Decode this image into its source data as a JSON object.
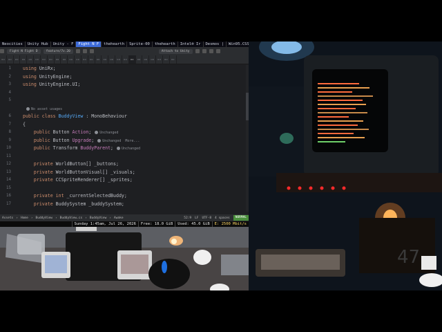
{
  "window_bar": {
    "tabs": [
      {
        "label": "Neocities",
        "active": false
      },
      {
        "label": "Unity Hub",
        "active": false
      },
      {
        "label": "Unity - F",
        "active": false
      },
      {
        "label": "Fight N F",
        "active": true
      },
      {
        "label": "thehearth",
        "active": false
      },
      {
        "label": "Sprite-00",
        "active": false
      },
      {
        "label": "thehearth",
        "active": false
      },
      {
        "label": "Intel® Ir",
        "active": false
      },
      {
        "label": "Desmos |",
        "active": false
      },
      {
        "label": "Win95.CSS",
        "active": false
      }
    ]
  },
  "ide": {
    "project_label": "Fight N Fight D",
    "branch_label": "feature/7v.20",
    "attach_label": "Attach to Unity",
    "code_lines": [
      {
        "n": "1",
        "parts": [
          {
            "t": "using",
            "c": "kw"
          },
          {
            "t": " UniRx;",
            "c": "ident"
          }
        ]
      },
      {
        "n": "2",
        "parts": [
          {
            "t": "using",
            "c": "kw"
          },
          {
            "t": " UnityEngine;",
            "c": "ident"
          }
        ]
      },
      {
        "n": "3",
        "parts": [
          {
            "t": "using",
            "c": "kw"
          },
          {
            "t": " UnityEngine.UI;",
            "c": "ident"
          }
        ]
      },
      {
        "n": "4",
        "parts": []
      },
      {
        "n": "5",
        "parts": []
      },
      {
        "n": "",
        "hint": "No asset usages"
      },
      {
        "n": "6",
        "parts": [
          {
            "t": "public class ",
            "c": "kw"
          },
          {
            "t": "BuddyView",
            "c": "cl"
          },
          {
            "t": " : MonoBehaviour",
            "c": "ident"
          }
        ]
      },
      {
        "n": "7",
        "parts": [
          {
            "t": "{",
            "c": "ident"
          }
        ]
      },
      {
        "n": "8",
        "parts": [
          {
            "t": "    public ",
            "c": "kw"
          },
          {
            "t": "Button ",
            "c": "ident"
          },
          {
            "t": "Action",
            "c": "ty"
          },
          {
            "t": ";",
            "c": "ident"
          }
        ],
        "hint": "Unchanged"
      },
      {
        "n": "9",
        "parts": [
          {
            "t": "    public ",
            "c": "kw"
          },
          {
            "t": "Button ",
            "c": "ident"
          },
          {
            "t": "Upgrade",
            "c": "ty"
          },
          {
            "t": ";",
            "c": "ident"
          }
        ],
        "hint": "Unchanged  More..."
      },
      {
        "n": "10",
        "parts": [
          {
            "t": "    public ",
            "c": "kw"
          },
          {
            "t": "Transform ",
            "c": "ident"
          },
          {
            "t": "BuddyParent",
            "c": "ty"
          },
          {
            "t": ";",
            "c": "ident"
          }
        ],
        "hint": "Unchanged"
      },
      {
        "n": "11",
        "parts": []
      },
      {
        "n": "12",
        "parts": [
          {
            "t": "    private ",
            "c": "kw"
          },
          {
            "t": "WorldButton[] _buttons;",
            "c": "ident"
          }
        ]
      },
      {
        "n": "13",
        "parts": [
          {
            "t": "    private ",
            "c": "kw"
          },
          {
            "t": "WorldButtonVisual[] _visuals;",
            "c": "ident"
          }
        ]
      },
      {
        "n": "14",
        "parts": [
          {
            "t": "    private ",
            "c": "kw"
          },
          {
            "t": "CCSpriteRenderer[] _sprites;",
            "c": "ident"
          }
        ]
      },
      {
        "n": "15",
        "parts": []
      },
      {
        "n": "16",
        "parts": [
          {
            "t": "    private int ",
            "c": "kw"
          },
          {
            "t": "_currentSelectedBuddy;",
            "c": "ident"
          }
        ]
      },
      {
        "n": "17",
        "parts": [
          {
            "t": "    private ",
            "c": "kw"
          },
          {
            "t": "BuddySystem _buddySystem;",
            "c": "ident"
          }
        ]
      }
    ],
    "status": {
      "breadcrumbs": [
        "Assets",
        "Home",
        "BuddyView",
        "BuddyView.cs",
        "BuddyView",
        "Awake"
      ],
      "position": "52:9",
      "line_sep": "LF",
      "encoding": "UTF-8",
      "indent": "4 spaces",
      "mode": "NORMAL"
    }
  },
  "polybar": {
    "datetime": "Sunday 1:45am, Jul 26, 2026",
    "free": "Free: 18.0 GiB",
    "used": "Used: 45.0 GiB",
    "net": "E: 2500 Mbit/s"
  },
  "camera": {
    "crt_number": "47"
  },
  "colors": {
    "ide_bg": "#1e1f22",
    "keyword": "#cf8e6d",
    "type": "#c77dbb",
    "class": "#56a8f5",
    "active_tab": "#3d6bd9",
    "mode_normal": "#4a8f3c"
  }
}
